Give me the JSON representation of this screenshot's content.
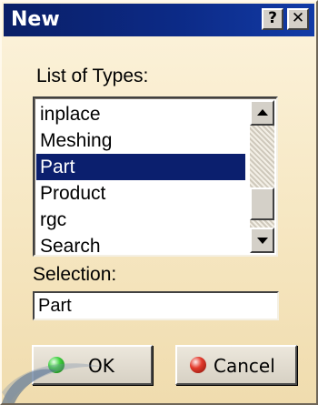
{
  "window": {
    "title": "New",
    "help_label": "?",
    "close_label": "✕"
  },
  "types": {
    "label": "List of Types:",
    "items": [
      "inplace",
      "Meshing",
      "Part",
      "Product",
      "rgc",
      "Search"
    ],
    "selected": "Part"
  },
  "selection": {
    "label": "Selection:",
    "value": "Part"
  },
  "buttons": {
    "ok_label": "OK",
    "cancel_label": "Cancel"
  },
  "icons": {
    "ok": "green-ball-icon",
    "cancel": "red-ball-icon",
    "scroll_up": "scroll-up-arrow-icon",
    "scroll_down": "scroll-down-arrow-icon"
  },
  "colors": {
    "titlebar": "#0c2a86",
    "selection_highlight": "#0b1f6e",
    "dialog_background": "#f6e7c2"
  }
}
